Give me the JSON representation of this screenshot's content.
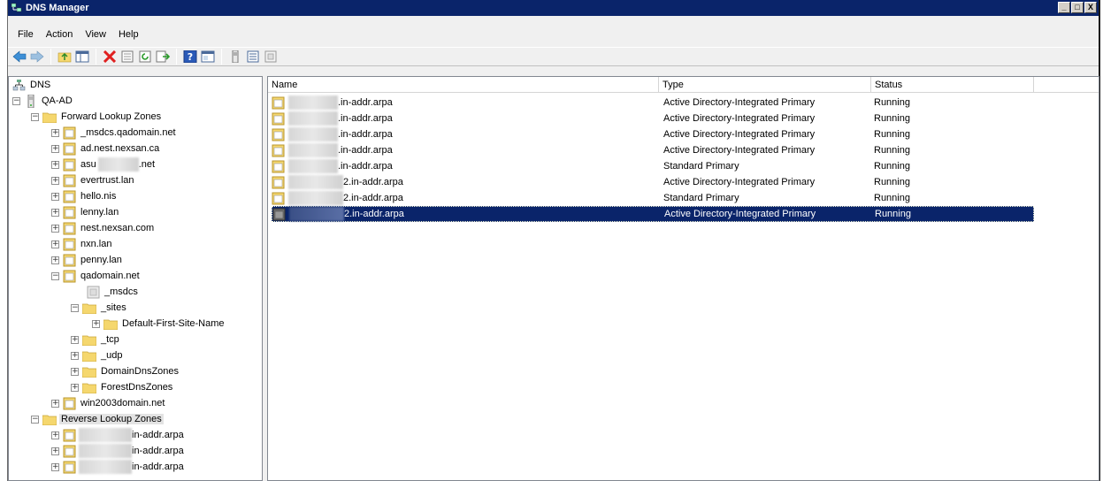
{
  "window": {
    "title": "DNS Manager",
    "controls": [
      "_",
      "□",
      "X"
    ]
  },
  "menu": [
    "File",
    "Action",
    "View",
    "Help"
  ],
  "toolbar": [
    "back-icon",
    "forward-icon",
    "up-folder-icon",
    "show-hide-tree-icon",
    "delete-icon",
    "properties-icon",
    "refresh-icon",
    "export-list-icon",
    "help-icon",
    "console-icon",
    "server-icon",
    "list-icon",
    "zone-icon"
  ],
  "tree": {
    "root": "DNS",
    "server": "QA-AD",
    "forward": "Forward Lookup Zones",
    "forward_zones": [
      "_msdcs.qadomain.net",
      "ad.nest.nexsan.ca",
      "asu",
      "evertrust.lan",
      "hello.nis",
      "lenny.lan",
      "nest.nexsan.com",
      "nxn.lan",
      "penny.lan",
      "qadomain.net"
    ],
    "asu_suffix": ".net",
    "qadomain_children": {
      "msdcs": "_msdcs",
      "sites": "_sites",
      "default_site": "Default-First-Site-Name",
      "tcp": "_tcp",
      "udp": "_udp",
      "domain_dns": "DomainDnsZones",
      "forest_dns": "ForestDnsZones"
    },
    "win2003": "win2003domain.net",
    "reverse": "Reverse Lookup Zones",
    "reverse_zones": [
      "in-addr.arpa",
      "in-addr.arpa",
      "in-addr.arpa"
    ]
  },
  "list": {
    "columns": {
      "name": "Name",
      "type": "Type",
      "status": "Status"
    },
    "rows": [
      {
        "name": ".in-addr.arpa",
        "type": "Active Directory-Integrated Primary",
        "status": "Running"
      },
      {
        "name": ".in-addr.arpa",
        "type": "Active Directory-Integrated Primary",
        "status": "Running"
      },
      {
        "name": ".in-addr.arpa",
        "type": "Active Directory-Integrated Primary",
        "status": "Running"
      },
      {
        "name": ".in-addr.arpa",
        "type": "Active Directory-Integrated Primary",
        "status": "Running"
      },
      {
        "name": ".in-addr.arpa",
        "type": "Standard Primary",
        "status": "Running"
      },
      {
        "name": "2.in-addr.arpa",
        "type": "Active Directory-Integrated Primary",
        "status": "Running"
      },
      {
        "name": "2.in-addr.arpa",
        "type": "Standard Primary",
        "status": "Running"
      },
      {
        "name": "2.in-addr.arpa",
        "type": "Active Directory-Integrated Primary",
        "status": "Running"
      }
    ]
  },
  "colors": {
    "titlebar": "#0a246a",
    "selection": "#0a246a",
    "folder": "#f5d76e"
  }
}
